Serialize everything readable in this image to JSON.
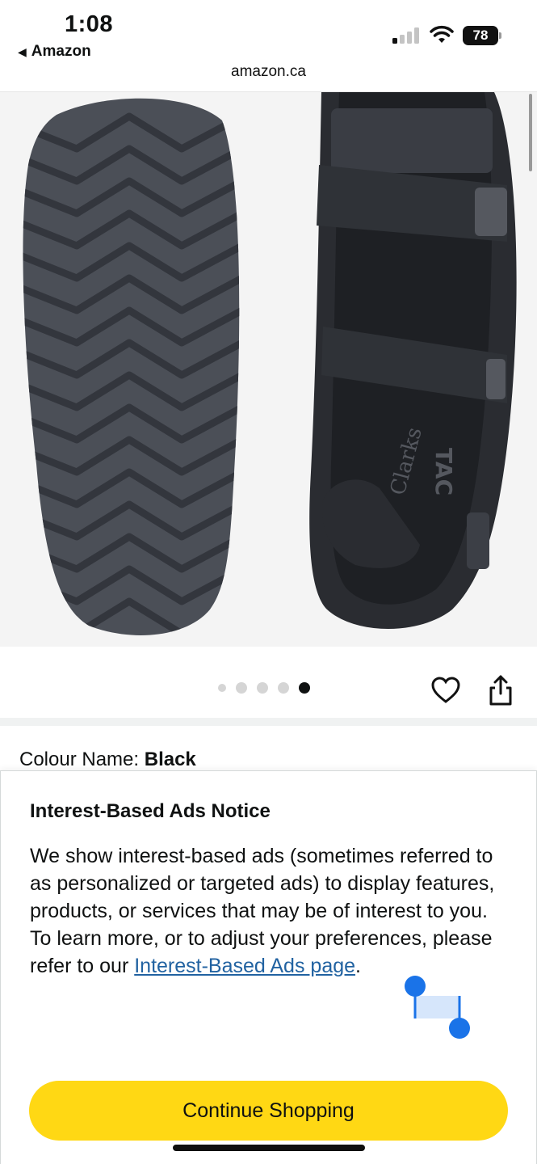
{
  "status_bar": {
    "time": "1:08",
    "back_app": "Amazon",
    "back_icon": "back-triangle-icon",
    "battery_level": "78",
    "signal_icon": "cellular-signal-icon",
    "wifi_icon": "wifi-icon"
  },
  "browser": {
    "url": "amazon.ca"
  },
  "product": {
    "image_alt": "Clarks sandal - sole and top views",
    "carousel_total": 5,
    "carousel_active_index": 4,
    "heart_icon": "heart-icon",
    "share_icon": "share-icon",
    "colour_label": "Colour Name:",
    "colour_value": "Black"
  },
  "notice": {
    "title": "Interest-Based Ads Notice",
    "body_text": "We show interest-based ads (sometimes referred to as personalized or targeted ads) to display features, products, or services that may be of interest to you. To learn more, or to adjust your preferences, please refer to our ",
    "link_text": "Interest-Based Ads page",
    "body_end": ".",
    "button_label": "Continue Shopping"
  },
  "colors": {
    "button_yellow": "#ffd814",
    "link_blue": "#2162a1",
    "selection_blue": "#1a73e8"
  }
}
